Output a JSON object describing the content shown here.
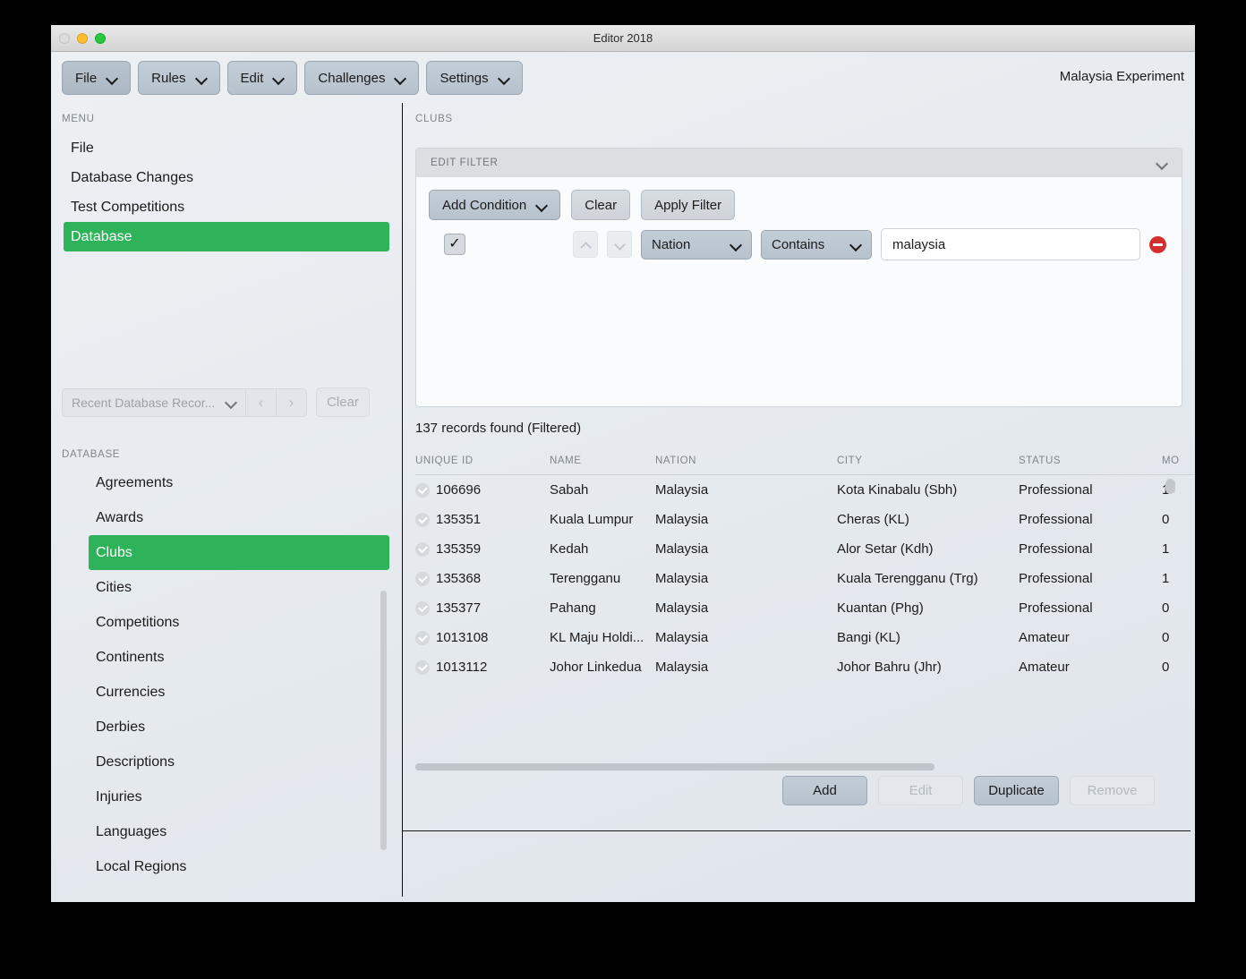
{
  "window": {
    "title": "Editor 2018",
    "traffic_lights": [
      "close-button",
      "minimize-button",
      "maximize-button"
    ]
  },
  "menubar": {
    "buttons": [
      {
        "label": "File",
        "icon": "chevron-down-icon"
      },
      {
        "label": "Rules",
        "icon": "chevron-down-icon"
      },
      {
        "label": "Edit",
        "icon": "chevron-down-icon"
      },
      {
        "label": "Challenges",
        "icon": "chevron-down-icon"
      },
      {
        "label": "Settings",
        "icon": "chevron-down-icon"
      }
    ],
    "project_title": "Malaysia Experiment"
  },
  "sidebar": {
    "menu_label": "MENU",
    "menu_items": [
      {
        "label": "File",
        "active": false
      },
      {
        "label": "Database Changes",
        "active": false
      },
      {
        "label": "Test Competitions",
        "active": false
      },
      {
        "label": "Database",
        "active": true
      }
    ],
    "recent": {
      "select_value": "Recent Database Recor...",
      "select_icon": "chevron-down-icon",
      "prev_icon": "chevron-left-icon",
      "next_icon": "chevron-right-icon",
      "clear_label": "Clear",
      "disabled": true
    },
    "database_label": "DATABASE",
    "database_items": [
      {
        "label": "Agreements",
        "active": false
      },
      {
        "label": "Awards",
        "active": false
      },
      {
        "label": "Clubs",
        "active": true
      },
      {
        "label": "Cities",
        "active": false
      },
      {
        "label": "Competitions",
        "active": false
      },
      {
        "label": "Continents",
        "active": false
      },
      {
        "label": "Currencies",
        "active": false
      },
      {
        "label": "Derbies",
        "active": false
      },
      {
        "label": "Descriptions",
        "active": false
      },
      {
        "label": "Injuries",
        "active": false
      },
      {
        "label": "Languages",
        "active": false
      },
      {
        "label": "Local Regions",
        "active": false
      }
    ]
  },
  "main": {
    "section_label": "CLUBS",
    "filter": {
      "header_label": "EDIT FILTER",
      "collapse_icon": "chevron-down-icon",
      "add_condition_label": "Add Condition",
      "add_condition_icon": "chevron-down-icon",
      "clear_label": "Clear",
      "apply_label": "Apply Filter",
      "condition": {
        "enabled_icon": "checkmark-icon",
        "move_up_icon": "chevron-up-icon",
        "move_down_icon": "chevron-down-icon",
        "field": "Nation",
        "operator": "Contains",
        "value": "malaysia",
        "value_placeholder": "",
        "remove_icon": "remove-circle-icon"
      }
    },
    "records_count": "137 records found (Filtered)",
    "table": {
      "columns": [
        "UNIQUE ID",
        "NAME",
        "NATION",
        "CITY",
        "STATUS",
        "MO"
      ],
      "rows": [
        {
          "id": "106696",
          "name": "Sabah",
          "nation": "Malaysia",
          "city": "Kota Kinabalu (Sbh)",
          "status": "Professional",
          "mo": "1"
        },
        {
          "id": "135351",
          "name": "Kuala Lumpur",
          "nation": "Malaysia",
          "city": "Cheras (KL)",
          "status": "Professional",
          "mo": "0"
        },
        {
          "id": "135359",
          "name": "Kedah",
          "nation": "Malaysia",
          "city": "Alor Setar (Kdh)",
          "status": "Professional",
          "mo": "1"
        },
        {
          "id": "135368",
          "name": "Terengganu",
          "nation": "Malaysia",
          "city": "Kuala Terengganu (Trg)",
          "status": "Professional",
          "mo": "1"
        },
        {
          "id": "135377",
          "name": "Pahang",
          "nation": "Malaysia",
          "city": "Kuantan (Phg)",
          "status": "Professional",
          "mo": "0"
        },
        {
          "id": "1013108",
          "name": "KL Maju Holdi...",
          "nation": "Malaysia",
          "city": "Bangi (KL)",
          "status": "Amateur",
          "mo": "0"
        },
        {
          "id": "1013112",
          "name": "Johor Linkedua",
          "nation": "Malaysia",
          "city": "Johor Bahru (Jhr)",
          "status": "Amateur",
          "mo": "0"
        }
      ]
    },
    "actions": [
      {
        "label": "Add",
        "enabled": true
      },
      {
        "label": "Edit",
        "enabled": false
      },
      {
        "label": "Duplicate",
        "enabled": true
      },
      {
        "label": "Remove",
        "enabled": false
      }
    ]
  },
  "colors": {
    "accent_green": "#2eb25a",
    "remove_red": "#d42f2f",
    "button_grey": "#bdc7d1",
    "panel_bg": "#fafbfc"
  }
}
